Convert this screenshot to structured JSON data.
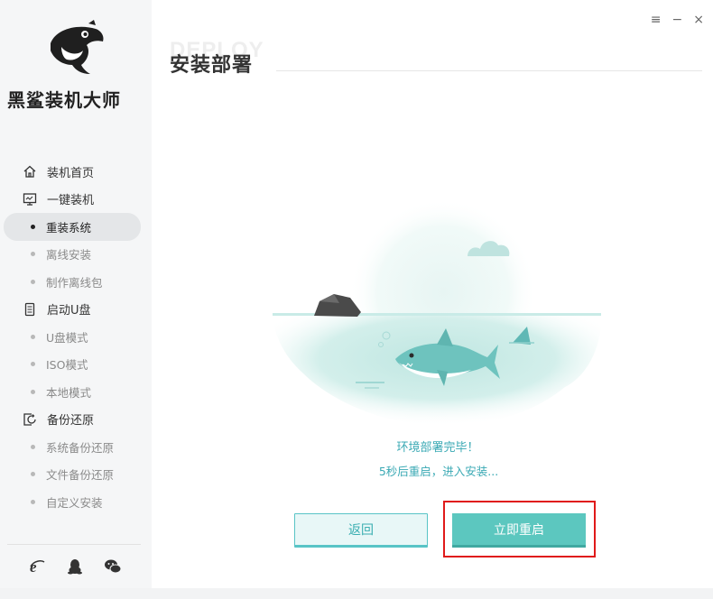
{
  "app": {
    "brand_name": "黑鲨装机大师",
    "bg_word": "DEPLOY",
    "page_title": "安装部署"
  },
  "window_controls": {
    "menu": "≡",
    "minimize": "−",
    "close": "×"
  },
  "sidebar": {
    "items": [
      {
        "type": "section",
        "icon": "home-icon",
        "label": "装机首页"
      },
      {
        "type": "section",
        "icon": "monitor-icon",
        "label": "一键装机"
      },
      {
        "type": "sub",
        "label": "重装系统",
        "active": true
      },
      {
        "type": "sub",
        "label": "离线安装"
      },
      {
        "type": "sub",
        "label": "制作离线包"
      },
      {
        "type": "section",
        "icon": "usb-drive-icon",
        "label": "启动U盘"
      },
      {
        "type": "sub",
        "label": "U盘模式"
      },
      {
        "type": "sub",
        "label": "ISO模式"
      },
      {
        "type": "sub",
        "label": "本地模式"
      },
      {
        "type": "section",
        "icon": "backup-restore-icon",
        "label": "备份还原"
      },
      {
        "type": "sub",
        "label": "系统备份还原"
      },
      {
        "type": "sub",
        "label": "文件备份还原"
      },
      {
        "type": "sub",
        "label": "自定义安装"
      }
    ],
    "footer_icons": [
      "ie-browser-icon",
      "qq-penguin-icon",
      "wechat-icon"
    ]
  },
  "status": {
    "line1": "环境部署完毕！",
    "line2": "5秒后重启，进入安装..."
  },
  "buttons": {
    "back": "返回",
    "restart_now": "立即重启"
  },
  "colors": {
    "accent": "#5cc7bf",
    "accent_text": "#3aa9b4",
    "highlight": "#e01a1a"
  }
}
